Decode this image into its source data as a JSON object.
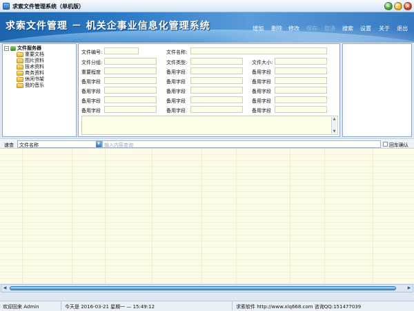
{
  "window": {
    "title": "求索文件管理系统（单机版）",
    "minimize": "–",
    "maximize": "□",
    "close": "×"
  },
  "header": {
    "title": "求索文件管理 － 机关企事业信息化管理系统",
    "menu": [
      {
        "label": "增加",
        "enabled": true
      },
      {
        "label": "删除",
        "enabled": true
      },
      {
        "label": "修改",
        "enabled": true
      },
      {
        "label": "保存",
        "enabled": false
      },
      {
        "label": "取消",
        "enabled": false
      },
      {
        "label": "搜索",
        "enabled": true
      },
      {
        "label": "设置",
        "enabled": true
      },
      {
        "label": "关于",
        "enabled": true
      },
      {
        "label": "退出",
        "enabled": true
      }
    ]
  },
  "tree": {
    "root": {
      "label": "文件服务器",
      "expander": "−"
    },
    "items": [
      "重要文档",
      "图片资料",
      "技术资料",
      "商务资料",
      "休闲书架",
      "我的音乐"
    ]
  },
  "form": {
    "fields": [
      [
        "文件编号:",
        "文件名称:",
        ""
      ],
      [
        "文件分组:",
        "文件类型:",
        "文件大小:"
      ],
      [
        "重要程度",
        "备用字段",
        "备用字段"
      ],
      [
        "备用字段",
        "备用字段",
        "备用字段"
      ],
      [
        "备用字段",
        "备用字段",
        "备用字段"
      ],
      [
        "备用字段",
        "备用字段",
        "备用字段"
      ],
      [
        "备用字段",
        "备用字段",
        "备用字段"
      ]
    ],
    "memo_scroll_up": "▲",
    "memo_scroll_down": "▼"
  },
  "search": {
    "label": "速查",
    "field": "文件名称",
    "field_dropdown": "▼",
    "placeholder": "输入内容查询",
    "enter_confirm": "回车确认"
  },
  "scroll": {
    "left": "◀",
    "right": "▶"
  },
  "status": {
    "welcome": "欢迎回来 Admin",
    "today": "今天是 2016-03-21 星期一 — 15:49:12",
    "company": "求索软件 http://www.xlq668.com 咨询QQ:151477039"
  },
  "colors": {
    "accent": "#2d7bc7",
    "input_bg": "#fefde8"
  }
}
